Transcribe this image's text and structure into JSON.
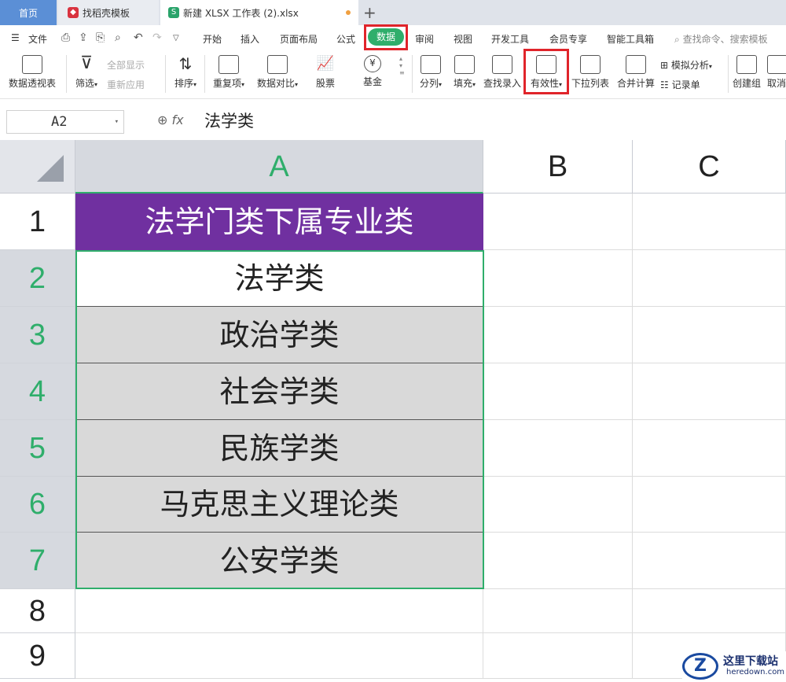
{
  "tabs": {
    "home": "首页",
    "template": "找稻壳模板",
    "file": "新建 XLSX 工作表 (2).xlsx",
    "add": "+"
  },
  "menu": {
    "file": "文件",
    "items": [
      "开始",
      "插入",
      "页面布局",
      "公式",
      "数据",
      "审阅",
      "视图",
      "开发工具",
      "会员专享",
      "智能工具箱"
    ],
    "search": "查找命令、搜索模板"
  },
  "ribbon": {
    "pivot": "数据透视表",
    "filter": "筛选",
    "show_all": "全部显示",
    "reapply": "重新应用",
    "sort": "排序",
    "duplicates": "重复项",
    "compare": "数据对比",
    "stock": "股票",
    "fund": "基金",
    "split": "分列",
    "fill": "填充",
    "lookup": "查找录入",
    "validity": "有效性",
    "dropdown": "下拉列表",
    "consolidate": "合并计算",
    "simulate": "模拟分析",
    "record": "记录单",
    "create_group": "创建组",
    "ungroup": "取消"
  },
  "formula_bar": {
    "name_box": "A2",
    "fx": "fx",
    "content": "法学类"
  },
  "grid": {
    "columns": [
      "A",
      "B",
      "C"
    ],
    "rows": [
      "1",
      "2",
      "3",
      "4",
      "5",
      "6",
      "7",
      "8",
      "9"
    ],
    "cells_A": [
      "法学门类下属专业类",
      "法学类",
      "政治学类",
      "社会学类",
      "民族学类",
      "马克思主义理论类",
      "公安学类"
    ],
    "selected_column": "A",
    "active_cell": "A2"
  },
  "watermark": {
    "logo": "Z",
    "text": "这里下载站",
    "sub": "heredown.com"
  },
  "colors": {
    "accent": "#2fae6b",
    "header_fill": "#7030a0",
    "highlight": "#e0242a"
  }
}
